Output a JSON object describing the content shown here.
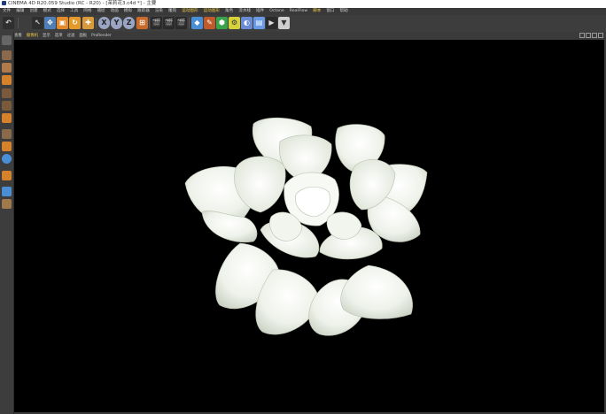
{
  "window": {
    "title": "CINEMA 4D R20.059 Studio (RC - R20) - [茉莉花3.c4d *] - 主要"
  },
  "menu": [
    {
      "label": "文件",
      "hl": false
    },
    {
      "label": "编辑",
      "hl": false
    },
    {
      "label": "创建",
      "hl": false
    },
    {
      "label": "模式",
      "hl": false
    },
    {
      "label": "选择",
      "hl": false
    },
    {
      "label": "工具",
      "hl": false
    },
    {
      "label": "网格",
      "hl": false
    },
    {
      "label": "捕捉",
      "hl": false
    },
    {
      "label": "动画",
      "hl": false
    },
    {
      "label": "模拟",
      "hl": false
    },
    {
      "label": "跟踪器",
      "hl": false
    },
    {
      "label": "渲染",
      "hl": false
    },
    {
      "label": "雕刻",
      "hl": false
    },
    {
      "label": "运动图形",
      "hl": true
    },
    {
      "label": "运动图形",
      "hl": true
    },
    {
      "label": "角色",
      "hl": false
    },
    {
      "label": "流水线",
      "hl": false
    },
    {
      "label": "插件",
      "hl": false
    },
    {
      "label": "Octane",
      "hl": false
    },
    {
      "label": "RealFlow",
      "hl": false
    },
    {
      "label": "脚本",
      "hl": true
    },
    {
      "label": "窗口",
      "hl": false
    },
    {
      "label": "帮助",
      "hl": false
    }
  ],
  "viewport_menu": [
    {
      "label": "查看",
      "hl": false
    },
    {
      "label": "摄像机",
      "hl": true
    },
    {
      "label": "显示",
      "hl": false
    },
    {
      "label": "选项",
      "hl": false
    },
    {
      "label": "过滤",
      "hl": false
    },
    {
      "label": "面板",
      "hl": false
    },
    {
      "label": "ProRender",
      "hl": false
    }
  ],
  "toolbar": {
    "axis_x": "X",
    "axis_y": "Y",
    "axis_z": "Z"
  },
  "colors": {
    "accent": "#e8c24a",
    "viewport_bg": "#000000",
    "ui_bg": "#3a3a3a"
  }
}
